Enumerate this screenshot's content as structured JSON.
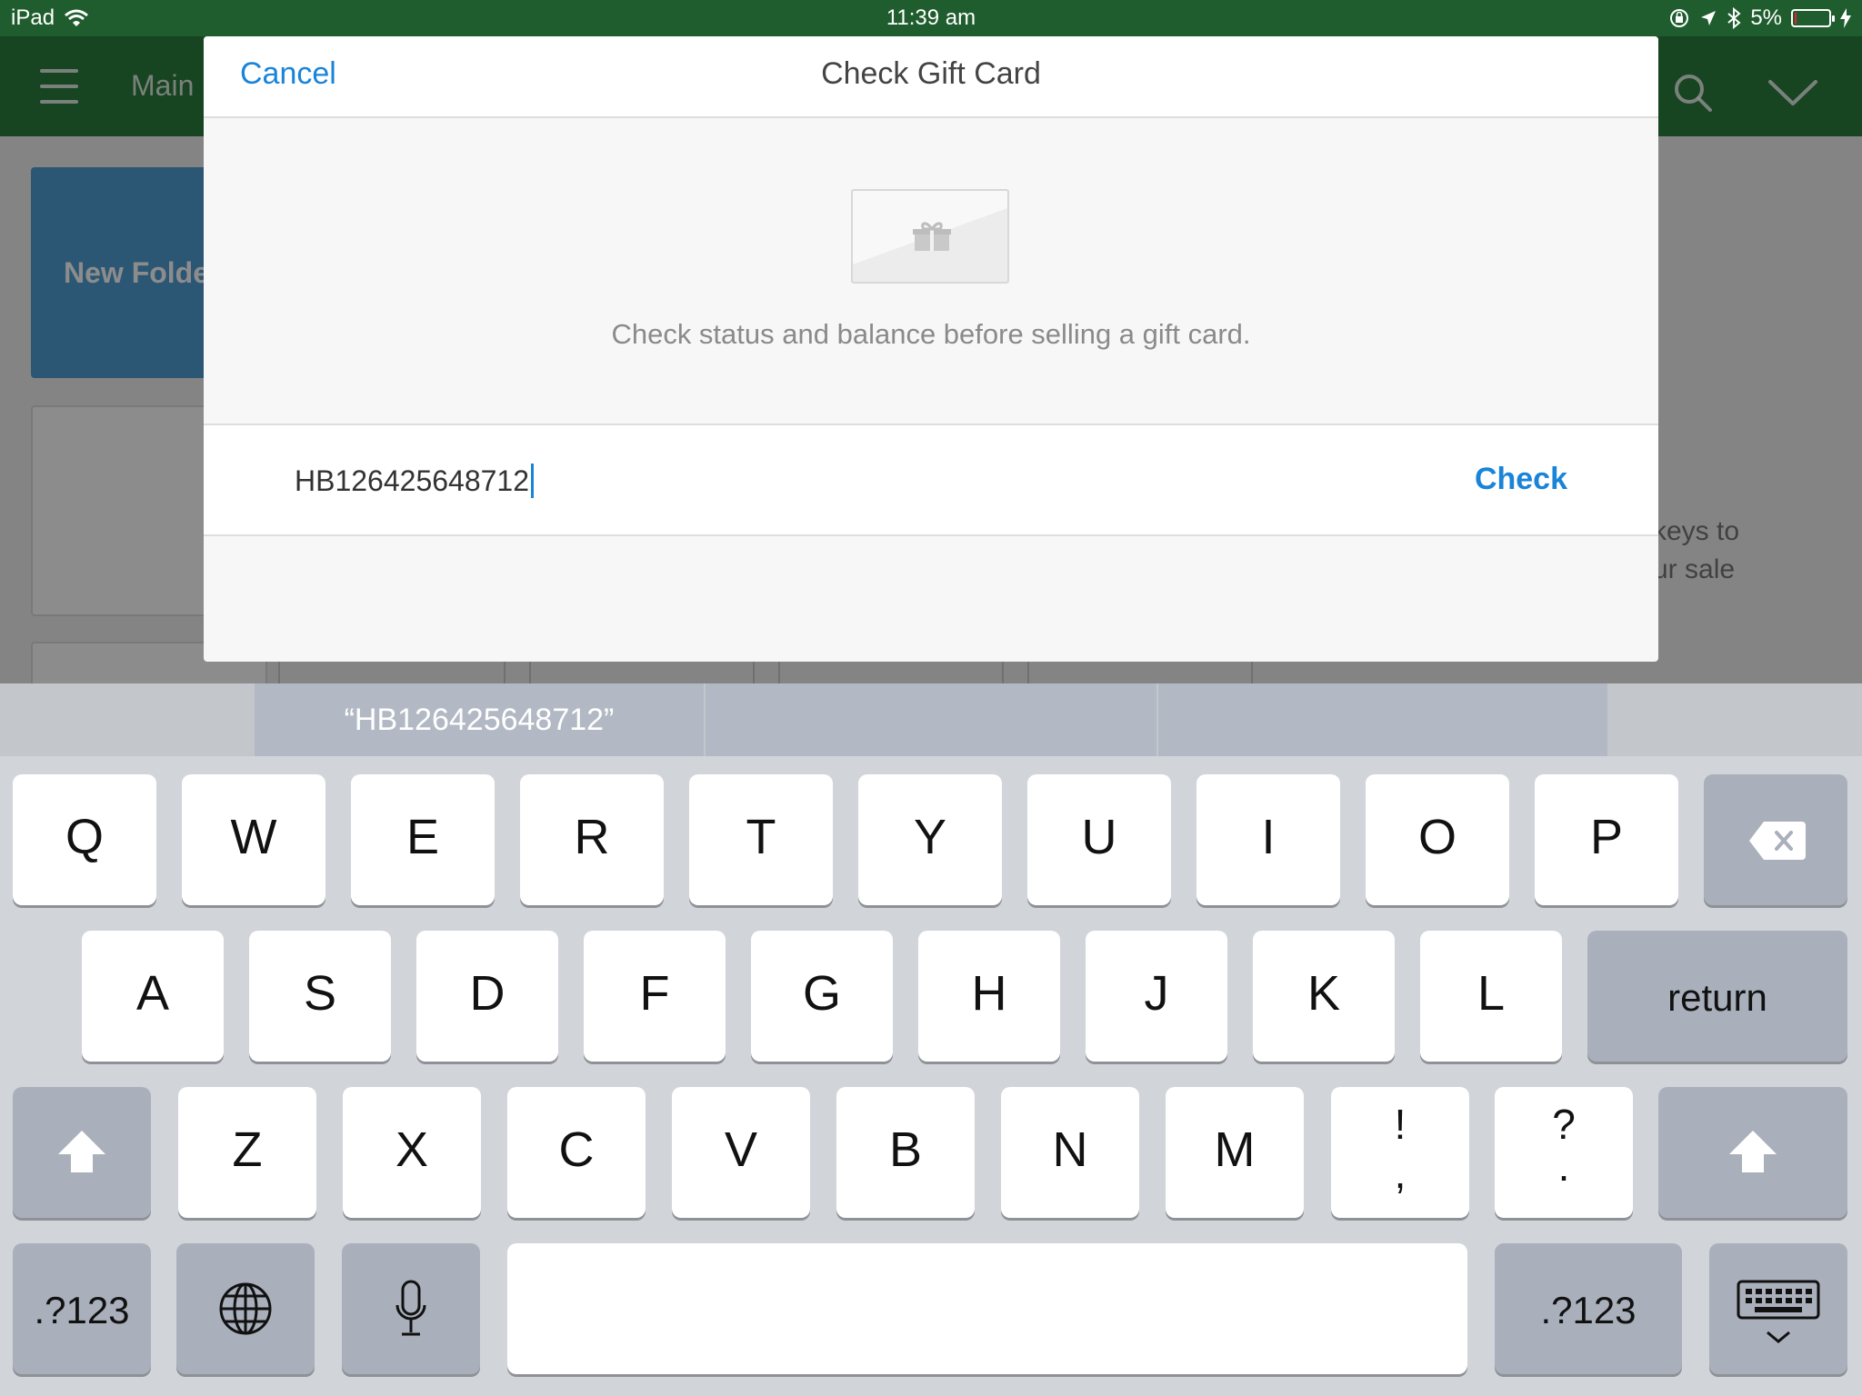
{
  "status_bar": {
    "device": "iPad",
    "time": "11:39 am",
    "battery": "5%",
    "battery_level": 0.05,
    "battery_color": "#e22233"
  },
  "nav": {
    "menu_icon": "hamburger-icon",
    "title": "Main",
    "search_icon": "search-icon",
    "dropdown_icon": "chevron-down-icon",
    "background": "#2a7d3c"
  },
  "background_content": {
    "folder_tile_label": "New Folde",
    "hint_lines": [
      "keys to",
      "ur sale"
    ]
  },
  "modal": {
    "cancel_label": "Cancel",
    "title": "Check Gift Card",
    "image_icon": "gift-card-icon",
    "description": "Check status and balance before selling a gift card.",
    "input_value": "HB126425648712",
    "check_label": "Check",
    "accent_color": "#1a84d8"
  },
  "keyboard": {
    "suggestions": [
      "“HB126425648712”",
      "",
      ""
    ],
    "row1": [
      "Q",
      "W",
      "E",
      "R",
      "T",
      "Y",
      "U",
      "I",
      "O",
      "P"
    ],
    "row2": [
      "A",
      "S",
      "D",
      "F",
      "G",
      "H",
      "J",
      "K",
      "L"
    ],
    "row3": [
      "Z",
      "X",
      "C",
      "V",
      "B",
      "N",
      "M"
    ],
    "punct1": [
      "!",
      ","
    ],
    "punct2": [
      "?",
      "."
    ],
    "return_label": "return",
    "numbers_label": ".?123",
    "backspace_icon": "backspace-icon",
    "shift_icon": "shift-icon",
    "globe_icon": "globe-icon",
    "mic_icon": "microphone-icon",
    "dismiss_icon": "keyboard-dismiss-icon"
  }
}
